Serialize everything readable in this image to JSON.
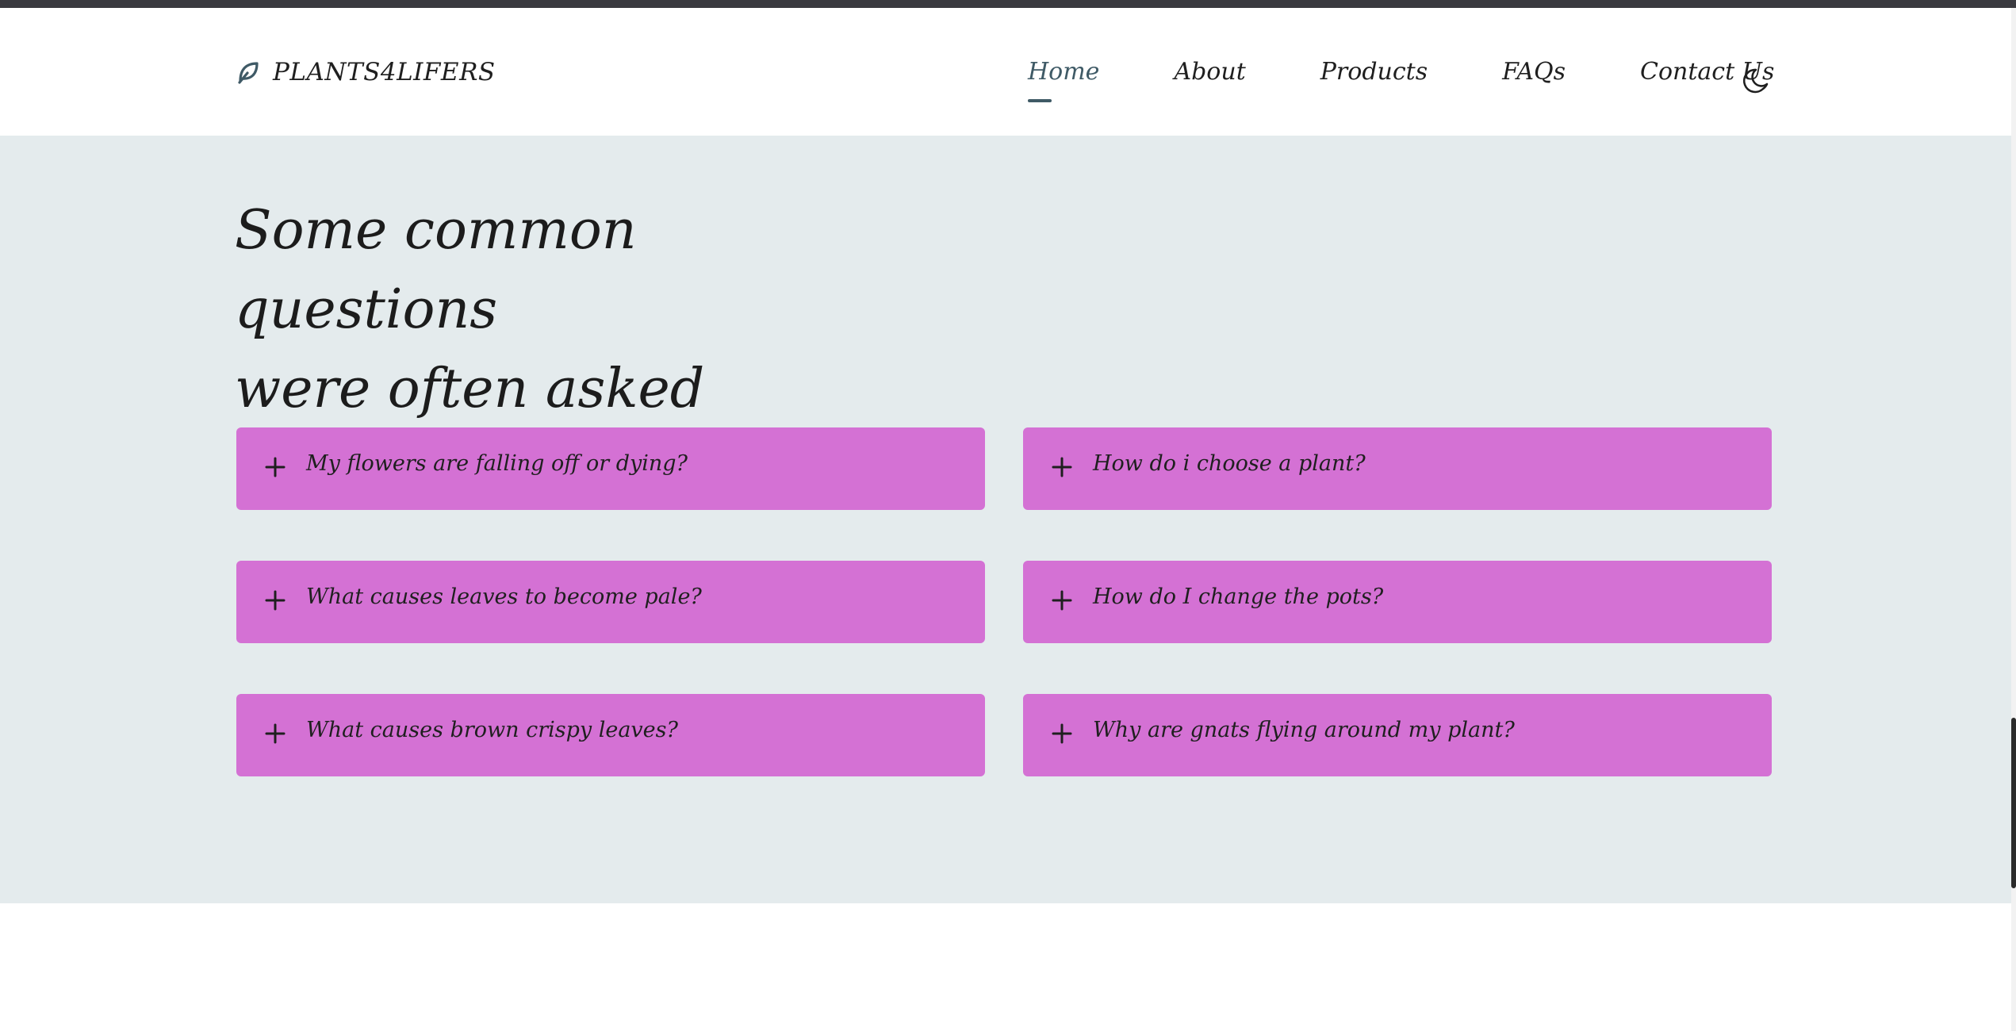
{
  "brand": {
    "name": "PLANTS4LIFERS",
    "icon": "leaf-icon",
    "accent_color": "#3f5a66"
  },
  "nav": {
    "items": [
      {
        "label": "Home",
        "active": true
      },
      {
        "label": "About",
        "active": false
      },
      {
        "label": "Products",
        "active": false
      },
      {
        "label": "FAQs",
        "active": false
      },
      {
        "label": "Contact Us",
        "active": false
      }
    ],
    "theme_icon": "moon-icon"
  },
  "faq": {
    "title_line1": "Some common questions",
    "title_line2": "were often asked",
    "item_color": "#d471d4",
    "section_background": "#e4ebed",
    "items": [
      {
        "question": "My flowers are falling off or dying?",
        "icon": "plus-icon"
      },
      {
        "question": "How do i choose a plant?",
        "icon": "plus-icon"
      },
      {
        "question": "What causes leaves to become pale?",
        "icon": "plus-icon"
      },
      {
        "question": "How do I change the pots?",
        "icon": "plus-icon"
      },
      {
        "question": "What causes brown crispy leaves?",
        "icon": "plus-icon"
      },
      {
        "question": "Why are gnats flying around my plant?",
        "icon": "plus-icon"
      }
    ]
  }
}
